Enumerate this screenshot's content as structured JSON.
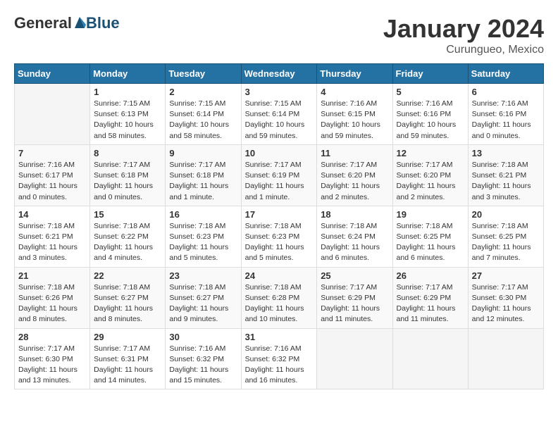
{
  "header": {
    "logo_general": "General",
    "logo_blue": "Blue",
    "month_year": "January 2024",
    "location": "Curungueo, Mexico"
  },
  "weekdays": [
    "Sunday",
    "Monday",
    "Tuesday",
    "Wednesday",
    "Thursday",
    "Friday",
    "Saturday"
  ],
  "weeks": [
    [
      {
        "day": "",
        "info": ""
      },
      {
        "day": "1",
        "info": "Sunrise: 7:15 AM\nSunset: 6:13 PM\nDaylight: 10 hours\nand 58 minutes."
      },
      {
        "day": "2",
        "info": "Sunrise: 7:15 AM\nSunset: 6:14 PM\nDaylight: 10 hours\nand 58 minutes."
      },
      {
        "day": "3",
        "info": "Sunrise: 7:15 AM\nSunset: 6:14 PM\nDaylight: 10 hours\nand 59 minutes."
      },
      {
        "day": "4",
        "info": "Sunrise: 7:16 AM\nSunset: 6:15 PM\nDaylight: 10 hours\nand 59 minutes."
      },
      {
        "day": "5",
        "info": "Sunrise: 7:16 AM\nSunset: 6:16 PM\nDaylight: 10 hours\nand 59 minutes."
      },
      {
        "day": "6",
        "info": "Sunrise: 7:16 AM\nSunset: 6:16 PM\nDaylight: 11 hours\nand 0 minutes."
      }
    ],
    [
      {
        "day": "7",
        "info": "Sunrise: 7:16 AM\nSunset: 6:17 PM\nDaylight: 11 hours\nand 0 minutes."
      },
      {
        "day": "8",
        "info": "Sunrise: 7:17 AM\nSunset: 6:18 PM\nDaylight: 11 hours\nand 0 minutes."
      },
      {
        "day": "9",
        "info": "Sunrise: 7:17 AM\nSunset: 6:18 PM\nDaylight: 11 hours\nand 1 minute."
      },
      {
        "day": "10",
        "info": "Sunrise: 7:17 AM\nSunset: 6:19 PM\nDaylight: 11 hours\nand 1 minute."
      },
      {
        "day": "11",
        "info": "Sunrise: 7:17 AM\nSunset: 6:20 PM\nDaylight: 11 hours\nand 2 minutes."
      },
      {
        "day": "12",
        "info": "Sunrise: 7:17 AM\nSunset: 6:20 PM\nDaylight: 11 hours\nand 2 minutes."
      },
      {
        "day": "13",
        "info": "Sunrise: 7:18 AM\nSunset: 6:21 PM\nDaylight: 11 hours\nand 3 minutes."
      }
    ],
    [
      {
        "day": "14",
        "info": "Sunrise: 7:18 AM\nSunset: 6:21 PM\nDaylight: 11 hours\nand 3 minutes."
      },
      {
        "day": "15",
        "info": "Sunrise: 7:18 AM\nSunset: 6:22 PM\nDaylight: 11 hours\nand 4 minutes."
      },
      {
        "day": "16",
        "info": "Sunrise: 7:18 AM\nSunset: 6:23 PM\nDaylight: 11 hours\nand 5 minutes."
      },
      {
        "day": "17",
        "info": "Sunrise: 7:18 AM\nSunset: 6:23 PM\nDaylight: 11 hours\nand 5 minutes."
      },
      {
        "day": "18",
        "info": "Sunrise: 7:18 AM\nSunset: 6:24 PM\nDaylight: 11 hours\nand 6 minutes."
      },
      {
        "day": "19",
        "info": "Sunrise: 7:18 AM\nSunset: 6:25 PM\nDaylight: 11 hours\nand 6 minutes."
      },
      {
        "day": "20",
        "info": "Sunrise: 7:18 AM\nSunset: 6:25 PM\nDaylight: 11 hours\nand 7 minutes."
      }
    ],
    [
      {
        "day": "21",
        "info": "Sunrise: 7:18 AM\nSunset: 6:26 PM\nDaylight: 11 hours\nand 8 minutes."
      },
      {
        "day": "22",
        "info": "Sunrise: 7:18 AM\nSunset: 6:27 PM\nDaylight: 11 hours\nand 8 minutes."
      },
      {
        "day": "23",
        "info": "Sunrise: 7:18 AM\nSunset: 6:27 PM\nDaylight: 11 hours\nand 9 minutes."
      },
      {
        "day": "24",
        "info": "Sunrise: 7:18 AM\nSunset: 6:28 PM\nDaylight: 11 hours\nand 10 minutes."
      },
      {
        "day": "25",
        "info": "Sunrise: 7:17 AM\nSunset: 6:29 PM\nDaylight: 11 hours\nand 11 minutes."
      },
      {
        "day": "26",
        "info": "Sunrise: 7:17 AM\nSunset: 6:29 PM\nDaylight: 11 hours\nand 11 minutes."
      },
      {
        "day": "27",
        "info": "Sunrise: 7:17 AM\nSunset: 6:30 PM\nDaylight: 11 hours\nand 12 minutes."
      }
    ],
    [
      {
        "day": "28",
        "info": "Sunrise: 7:17 AM\nSunset: 6:30 PM\nDaylight: 11 hours\nand 13 minutes."
      },
      {
        "day": "29",
        "info": "Sunrise: 7:17 AM\nSunset: 6:31 PM\nDaylight: 11 hours\nand 14 minutes."
      },
      {
        "day": "30",
        "info": "Sunrise: 7:16 AM\nSunset: 6:32 PM\nDaylight: 11 hours\nand 15 minutes."
      },
      {
        "day": "31",
        "info": "Sunrise: 7:16 AM\nSunset: 6:32 PM\nDaylight: 11 hours\nand 16 minutes."
      },
      {
        "day": "",
        "info": ""
      },
      {
        "day": "",
        "info": ""
      },
      {
        "day": "",
        "info": ""
      }
    ]
  ]
}
